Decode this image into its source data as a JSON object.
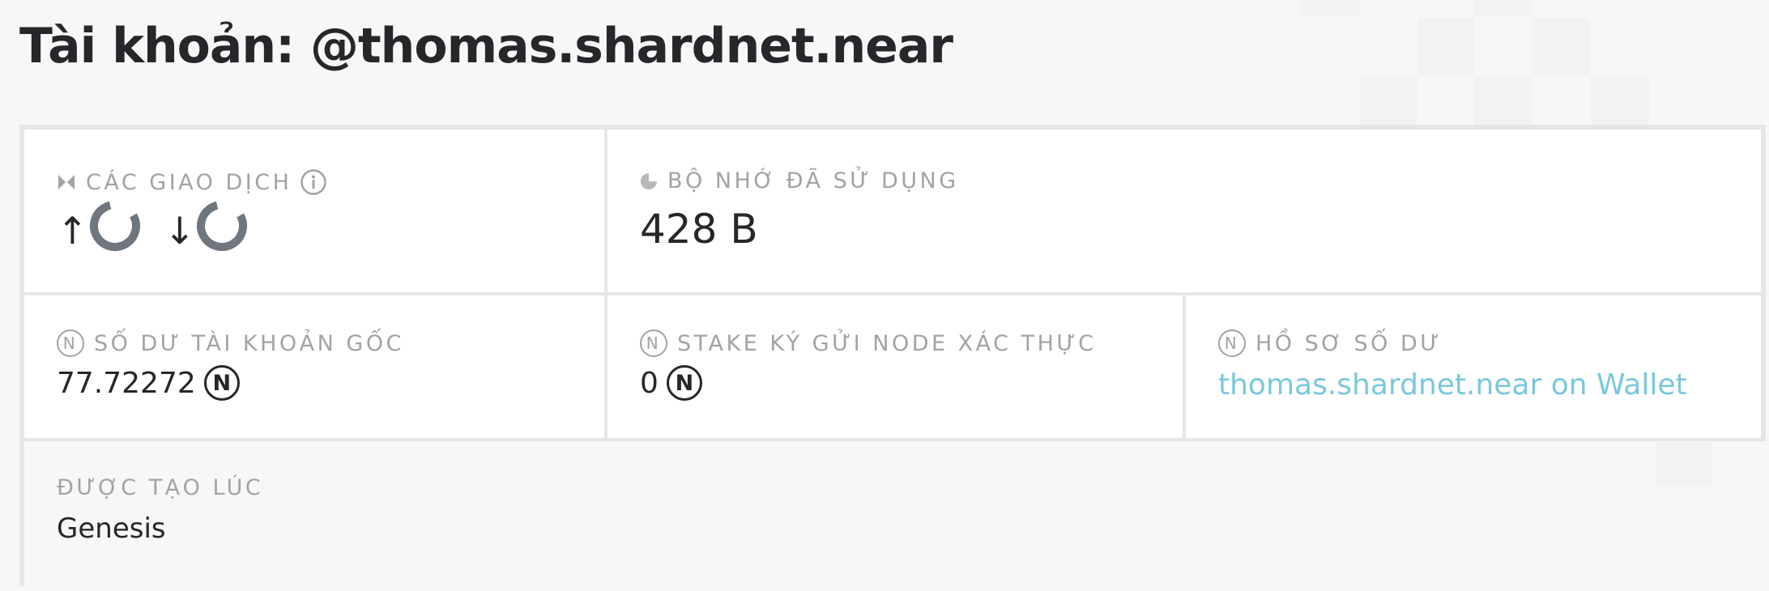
{
  "page_title": "Tài khoản: @thomas.shardnet.near",
  "transactions": {
    "label": "CÁC GIAO DỊCH",
    "in_arrow": "↑",
    "out_arrow": "↓",
    "icon": "transfer-icon",
    "info_icon": "info-icon"
  },
  "storage": {
    "label": "BỘ NHỚ ĐÃ SỬ DỤNG",
    "value": "428 B",
    "icon": "storage-pie-icon"
  },
  "native_balance": {
    "label": "SỐ DƯ TÀI KHOẢN GỐC",
    "value": "77.72272",
    "icon": "near-icon"
  },
  "validator_stake": {
    "label": "STAKE KÝ GỬI NODE XÁC THỰC",
    "value": "0",
    "icon": "near-icon"
  },
  "balance_profile": {
    "label": "HỒ SƠ SỐ DƯ",
    "link_text": "thomas.shardnet.near on Wallet",
    "icon": "near-icon"
  },
  "created": {
    "label": "ĐƯỢC TẠO LÚC",
    "value": "Genesis"
  },
  "near_symbol": "N",
  "colors": {
    "text": "#25272a",
    "muted": "#a2a2a8",
    "link": "#7ac8dc",
    "spinner": "#6f767e",
    "border": "#e6e6e6"
  }
}
